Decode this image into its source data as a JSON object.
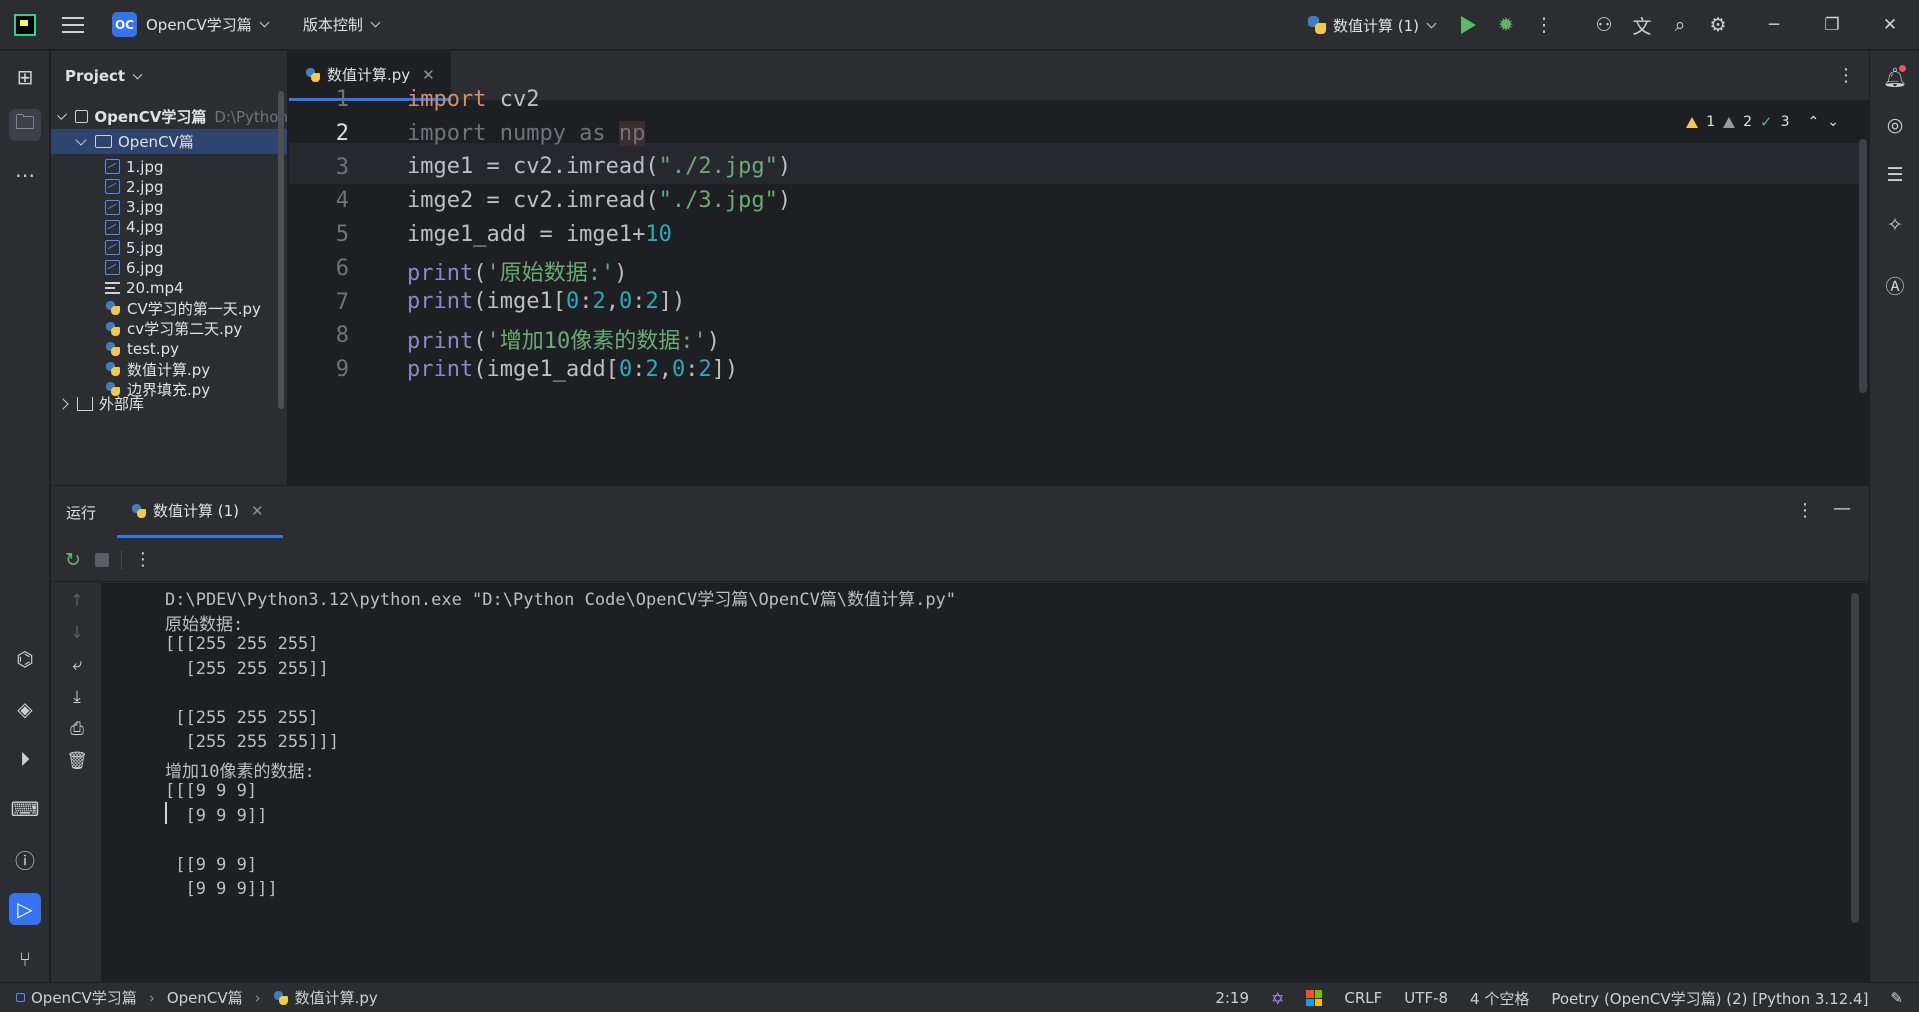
{
  "titlebar": {
    "project_badge": "OC",
    "project_name": "OpenCV学习篇",
    "vcs_label": "版本控制",
    "run_config": "数值计算 (1)"
  },
  "project_panel": {
    "title": "Project",
    "root_name": "OpenCV学习篇",
    "root_path": "D:\\Python",
    "folder_name": "OpenCV篇",
    "files": [
      "1.jpg",
      "2.jpg",
      "3.jpg",
      "4.jpg",
      "5.jpg",
      "6.jpg",
      "20.mp4",
      "CV学习的第一天.py",
      "cv学习第二天.py",
      "test.py",
      "数值计算.py",
      "边界填充.py"
    ],
    "file_types": [
      "image",
      "image",
      "image",
      "image",
      "image",
      "image",
      "text",
      "python",
      "python",
      "python",
      "python",
      "python"
    ],
    "external_libs": "外部库"
  },
  "editor": {
    "tab_label": "数值计算.py",
    "inspections": {
      "warnings": "1",
      "weak_warnings": "2",
      "ok": "3"
    },
    "line_numbers": [
      "1",
      "2",
      "3",
      "4",
      "5",
      "6",
      "7",
      "8",
      "9"
    ]
  },
  "run_panel": {
    "title": "运行",
    "tab_label": "数值计算 (1)",
    "output": [
      "D:\\PDEV\\Python3.12\\python.exe \"D:\\Python Code\\OpenCV学习篇\\OpenCV篇\\数值计算.py\"",
      "原始数据:",
      "[[[255 255 255]",
      "  [255 255 255]]",
      "",
      " [[255 255 255]",
      "  [255 255 255]]]",
      "增加10像素的数据:",
      "[[[9 9 9]",
      "  [9 9 9]]",
      "",
      " [[9 9 9]",
      "  [9 9 9]]]"
    ]
  },
  "statusbar": {
    "breadcrumb": [
      "OpenCV学习篇",
      "OpenCV篇",
      "数值计算.py"
    ],
    "position": "2:19",
    "line_ending": "CRLF",
    "encoding": "UTF-8",
    "indent": "4 个空格",
    "interpreter": "Poetry (OpenCV学习篇) (2) [Python 3.12.4]"
  }
}
